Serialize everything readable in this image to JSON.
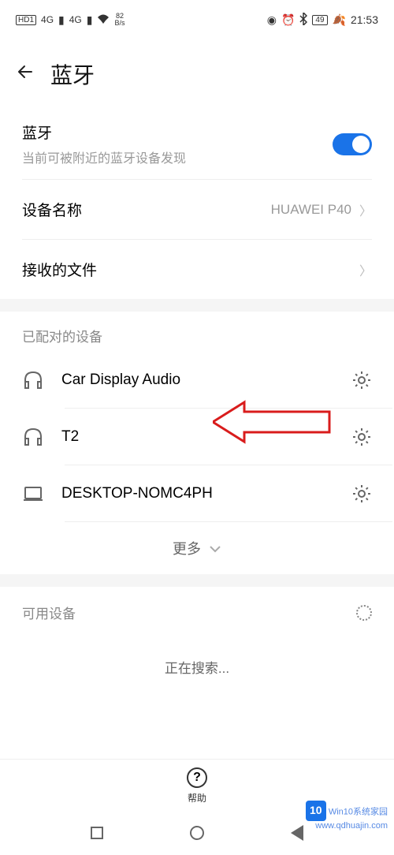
{
  "statusbar": {
    "hd": "HD1",
    "signal": "4G",
    "bs_num": "82",
    "bs_unit": "B/s",
    "battery": "49",
    "time": "21:53"
  },
  "header": {
    "title": "蓝牙"
  },
  "bluetooth": {
    "label": "蓝牙",
    "subtitle": "当前可被附近的蓝牙设备发现"
  },
  "device_name": {
    "label": "设备名称",
    "value": "HUAWEI P40"
  },
  "received": {
    "label": "接收的文件"
  },
  "paired": {
    "header": "已配对的设备",
    "devices": [
      {
        "name": "Car Display Audio",
        "icon": "headphones"
      },
      {
        "name": "T2",
        "icon": "headphones"
      },
      {
        "name": "DESKTOP-NOMC4PH",
        "icon": "laptop"
      }
    ],
    "more": "更多"
  },
  "available": {
    "header": "可用设备",
    "searching": "正在搜索..."
  },
  "help": {
    "label": "帮助"
  },
  "watermark": {
    "line1": "Win10系统家园",
    "line2": "www.qdhuajin.com"
  }
}
